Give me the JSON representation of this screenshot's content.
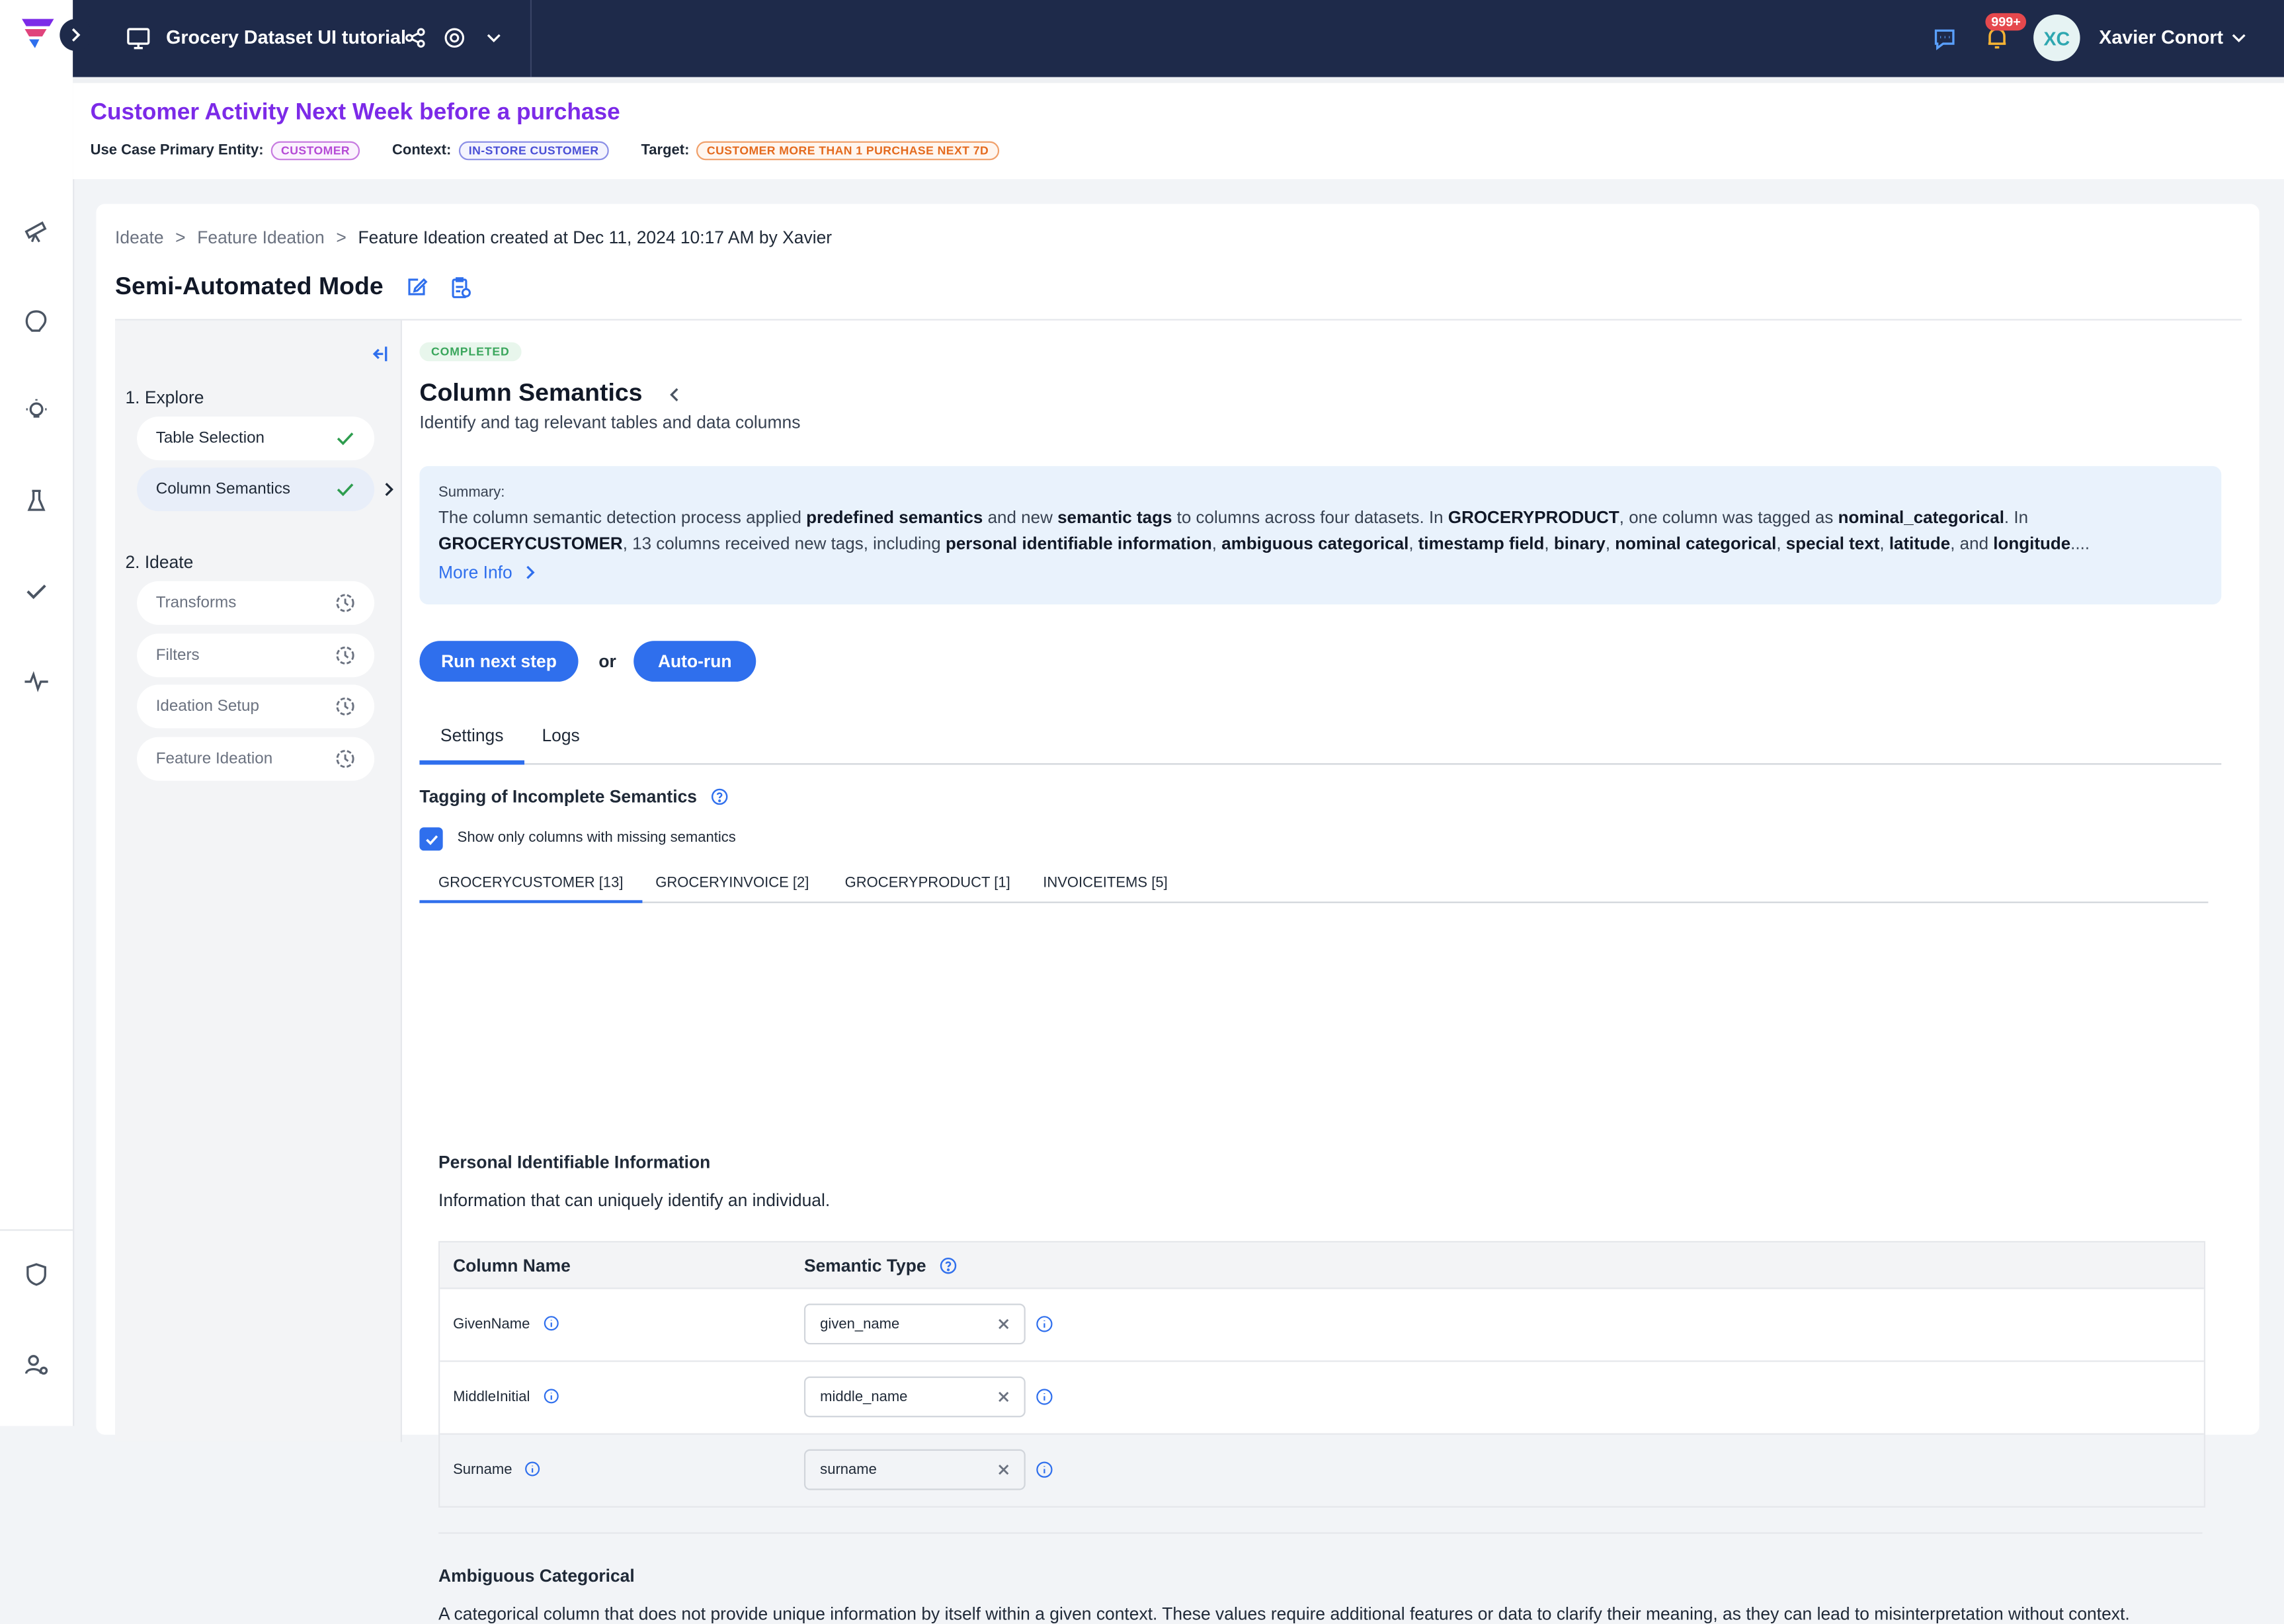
{
  "topbar": {
    "project_title": "Grocery Dataset UI tutorial",
    "notification_count": "999+",
    "user_initials": "XC",
    "user_name": "Xavier Conort"
  },
  "use_case": {
    "title": "Customer Activity Next Week before a purchase",
    "primary_entity_label": "Use Case Primary Entity:",
    "primary_entity": "CUSTOMER",
    "context_label": "Context:",
    "context": "IN-STORE CUSTOMER",
    "target_label": "Target:",
    "target": "CUSTOMER MORE THAN 1 PURCHASE NEXT 7D"
  },
  "breadcrumb": {
    "items": [
      "Ideate",
      "Feature Ideation"
    ],
    "current": "Feature Ideation created at Dec 11, 2024 10:17 AM by Xavier",
    "separator": ">"
  },
  "mode_title": "Semi-Automated Mode",
  "steps": {
    "explore_heading": "1. Explore",
    "explore_items": [
      "Table Selection",
      "Column Semantics"
    ],
    "ideate_heading": "2. Ideate",
    "ideate_items": [
      "Transforms",
      "Filters",
      "Ideation Setup",
      "Feature Ideation"
    ]
  },
  "content": {
    "status": "COMPLETED",
    "title": "Column Semantics",
    "subtitle": "Identify and tag relevant tables and data columns",
    "summary_heading": "Summary:",
    "more_info": "More Info",
    "run_next_step": "Run next step",
    "or": "or",
    "auto_run": "Auto-run",
    "tabs": [
      "Settings",
      "Logs"
    ],
    "section_title": "Tagging of Incomplete Semantics",
    "checkbox_label": "Show only columns with missing semantics",
    "dataset_tabs": [
      "GROCERYCUSTOMER [13]",
      "GROCERYINVOICE [2]",
      "GROCERYPRODUCT [1]",
      "INVOICEITEMS [5]"
    ]
  },
  "group1": {
    "title": "Personal Identifiable Information",
    "description": "Information that can uniquely identify an individual.",
    "col_header_name": "Column Name",
    "col_header_type": "Semantic Type",
    "rows": [
      {
        "column": "GivenName",
        "semantic": "given_name"
      },
      {
        "column": "MiddleInitial",
        "semantic": "middle_name"
      },
      {
        "column": "Surname",
        "semantic": "surname"
      }
    ]
  },
  "group2": {
    "title": "Ambiguous Categorical",
    "description": "A categorical column that does not provide unique information by itself within a given context. These values require additional features or data to clarify their meaning, as they can lead to misinterpretation without context."
  },
  "colors": {
    "topbar": "#1e2a4a",
    "accent": "#2f6fed",
    "usecase_title": "#7c2ae8",
    "completed": "#3aa65c"
  }
}
